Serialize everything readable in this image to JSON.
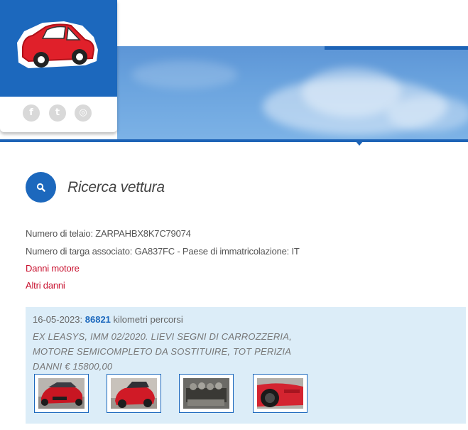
{
  "header": {
    "logo_icon": "red-car-logo",
    "social": [
      {
        "name": "facebook",
        "glyph": "f"
      },
      {
        "name": "twitter",
        "glyph": "t"
      },
      {
        "name": "instagram",
        "glyph": "◎"
      }
    ],
    "colors": {
      "brand_blue": "#1c68bd",
      "car_red": "#e0202a"
    }
  },
  "search": {
    "icon": "search-icon",
    "title": "Ricerca vettura"
  },
  "vehicle": {
    "chassis_line": "Numero di telaio: ZARPAHBX8K7C79074",
    "plate_line": "Numero di targa associato: GA837FC - Paese di immatricolazione: IT",
    "links": [
      "Danni motore",
      "Altri danni"
    ]
  },
  "record": {
    "date": "16-05-2023:",
    "km": "86821",
    "km_label": "kilometri percorsi",
    "description": "EX LEASYS, IMM 02/2020. LIEVI SEGNI DI CARROZZERIA, MOTORE SEMICOMPLETO DA SOSTITUIRE, TOT PERIZIA DANNI € 15800,00",
    "photos": [
      {
        "name": "photo-front-red-car"
      },
      {
        "name": "photo-rear-red-car"
      },
      {
        "name": "photo-engine"
      },
      {
        "name": "photo-wheel-side"
      }
    ]
  }
}
